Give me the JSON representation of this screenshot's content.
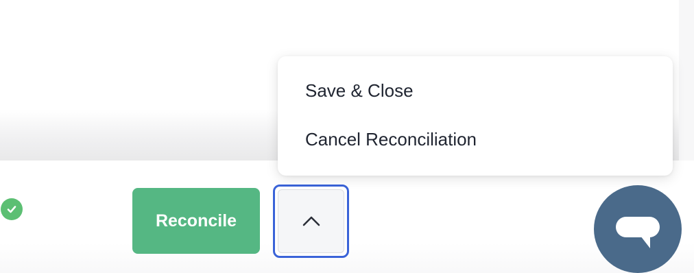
{
  "menu": {
    "items": [
      {
        "label": "Save & Close"
      },
      {
        "label": "Cancel Reconciliation"
      }
    ]
  },
  "footer": {
    "reconcile_label": "Reconcile",
    "status_icon": "check-circle-icon",
    "toggle_icon": "chevron-up-icon"
  },
  "chat": {
    "icon": "chat-bubble-icon"
  },
  "colors": {
    "reconcile_button": "#55b783",
    "status_check": "#5cbf73",
    "focus_ring": "#3a63d8",
    "chat_bubble": "#4a6a8a",
    "menu_text": "#1f2430"
  }
}
